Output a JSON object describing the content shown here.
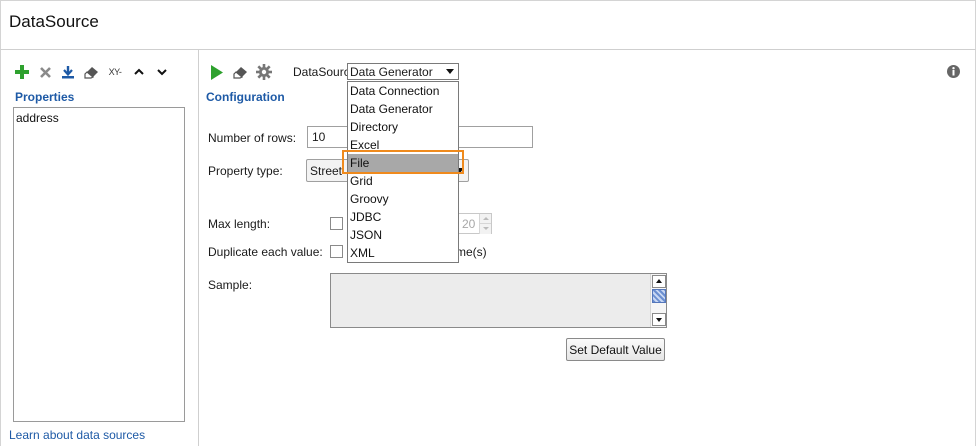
{
  "window": {
    "title": "DataSource"
  },
  "left_panel": {
    "properties_label": "Properties",
    "properties": [
      "address"
    ],
    "xy_label": "XY-",
    "learn_link": "Learn about data sources"
  },
  "toolbar": {
    "datasource_label": "DataSource:",
    "datasource_value": "Data Generator"
  },
  "config": {
    "header": "Configuration",
    "num_rows_label": "Number of rows:",
    "num_rows_value": "10",
    "property_type_label": "Property type:",
    "property_type_value": "Street",
    "max_length_label": "Max length:",
    "max_length_value": "20",
    "duplicate_label": "Duplicate each value:",
    "times_suffix": "me(s)",
    "sample_label": "Sample:",
    "set_default_button": "Set Default Value"
  },
  "dropdown": {
    "options": [
      "Data Connection",
      "Data Generator",
      "Directory",
      "Excel",
      "File",
      "Grid",
      "Groovy",
      "JDBC",
      "JSON",
      "XML"
    ],
    "highlighted": "File"
  },
  "colors": {
    "accent_blue": "#1e5aa6",
    "add_green": "#2ea12e",
    "highlight_orange": "#ef8a1d"
  }
}
